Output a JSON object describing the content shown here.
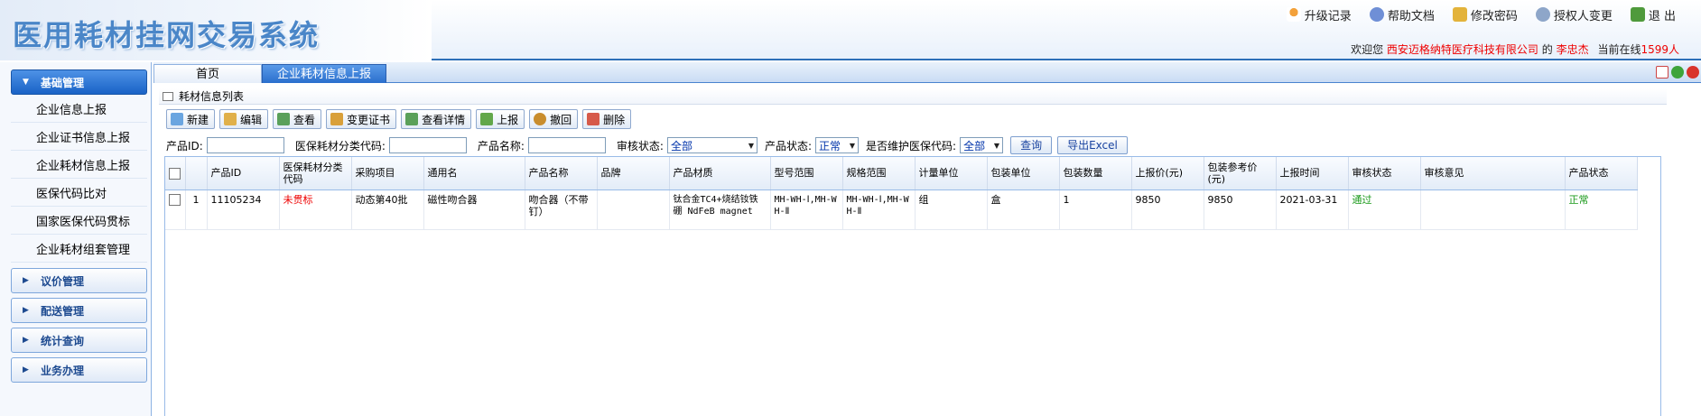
{
  "app": {
    "title": "医用耗材挂网交易系统",
    "welcome_prefix": "欢迎您",
    "company": "西安迈格纳特医疗科技有限公司",
    "de": "的",
    "user": "李忠杰",
    "online_prefix": "当前在线",
    "online_count": "1599人"
  },
  "top_links": [
    {
      "label": "升级记录",
      "icon": "upgrade-icon"
    },
    {
      "label": "帮助文档",
      "icon": "help-icon"
    },
    {
      "label": "修改密码",
      "icon": "lock-icon"
    },
    {
      "label": "授权人变更",
      "icon": "user-change-icon"
    },
    {
      "label": "退 出",
      "icon": "exit-icon"
    }
  ],
  "sidebar": {
    "sections": [
      {
        "label": "基础管理",
        "expanded": true
      },
      {
        "label": "议价管理",
        "expanded": false
      },
      {
        "label": "配送管理",
        "expanded": false
      },
      {
        "label": "统计查询",
        "expanded": false
      },
      {
        "label": "业务办理",
        "expanded": false
      }
    ],
    "items": [
      "企业信息上报",
      "企业证书信息上报",
      "企业耗材信息上报",
      "医保代码比对",
      "国家医保代码贯标",
      "企业耗材组套管理"
    ]
  },
  "tabs": {
    "home": "首页",
    "current": "企业耗材信息上报"
  },
  "panel": {
    "title": "耗材信息列表"
  },
  "toolbar": [
    "新建",
    "编辑",
    "查看",
    "变更证书",
    "查看详情",
    "上报",
    "撤回",
    "删除"
  ],
  "filters": {
    "product_id_label": "产品ID:",
    "category_code_label": "医保耗材分类代码:",
    "product_name_label": "产品名称:",
    "audit_status_label": "审核状态:",
    "audit_status_value": "全部",
    "product_status_label": "产品状态:",
    "product_status_value": "正常",
    "maintain_code_label": "是否维护医保代码:",
    "maintain_code_value": "全部",
    "query_button": "查询",
    "export_button": "导出Excel"
  },
  "table": {
    "columns": [
      "产品ID",
      "医保耗材分类代码",
      "采购项目",
      "通用名",
      "产品名称",
      "品牌",
      "产品材质",
      "型号范围",
      "规格范围",
      "计量单位",
      "包装单位",
      "包装数量",
      "上报价(元)",
      "包装参考价(元)",
      "上报时间",
      "审核状态",
      "审核意见",
      "产品状态"
    ],
    "rows": [
      {
        "index": "1",
        "cells": [
          "11105234",
          "未贯标",
          "动态第40批",
          "磁性吻合器",
          "吻合器（不带钉）",
          "",
          "钛合金TC4+烧结钕铁硼 NdFeB magnet",
          "MH-WH-Ⅰ,MH-WH-Ⅱ",
          "MH-WH-Ⅰ,MH-WH-Ⅱ",
          "组",
          "盒",
          "1",
          "9850",
          "9850",
          "2021-03-31",
          "通过",
          "",
          "正常"
        ]
      }
    ]
  },
  "colors": {
    "accent": "#1962c6",
    "header_line": "#2d6fb8",
    "status_red": "#e00000",
    "status_green": "#1a9a1a"
  }
}
